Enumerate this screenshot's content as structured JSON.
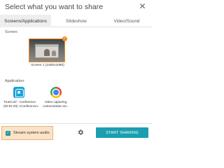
{
  "dialog": {
    "title": "Select what you want to share",
    "close_icon": "close-icon"
  },
  "tabs": [
    {
      "label": "Screens/Applications",
      "active": true
    },
    {
      "label": "Slideshow",
      "active": false
    },
    {
      "label": "Video/Sound",
      "active": false
    }
  ],
  "screens": {
    "label": "Screen:",
    "items": [
      {
        "caption": "Screen 1 (1920x1080)",
        "selected": true
      }
    ]
  },
  "applications": {
    "label": "Application:",
    "items": [
      {
        "icon": "trueconf-icon",
        "caption_line1": "TrueConf - Conference",
        "caption_line2": "(00:01:20) «Conference»"
      },
      {
        "icon": "chrome-icon",
        "caption_line1": "Video capturing,",
        "caption_line2": "customization an..."
      }
    ]
  },
  "footer": {
    "audio_label": "Stream system audio",
    "audio_checked": true,
    "settings_icon": "gear-icon",
    "start_label": "START SHARING"
  },
  "colors": {
    "accent": "#1b9fb0",
    "highlight": "#ef8a23",
    "checkbox": "#1e9e9a"
  }
}
